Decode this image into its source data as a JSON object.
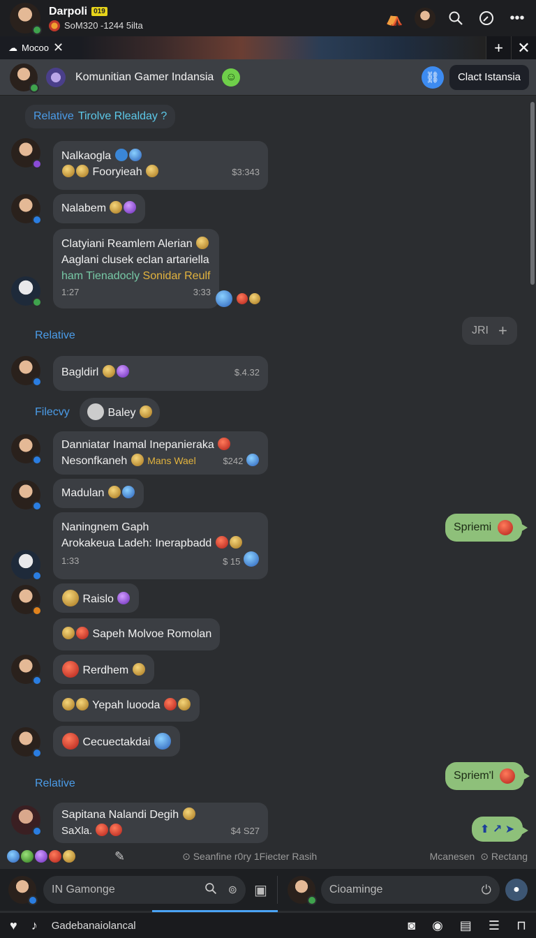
{
  "topbar": {
    "name": "Darpoli",
    "tag": "019",
    "subtitle": "SoM320 -1244 5ilta"
  },
  "banner": {
    "tab_label": "Mocoo"
  },
  "group": {
    "name": "Komunitian Gamer Indansia",
    "pill_label": "Clact Istansia"
  },
  "messages": [
    {
      "type": "system",
      "text": "Relative",
      "alt": "Tirolve Rlealday ?"
    },
    {
      "type": "msg",
      "line1": "Nalkaogla",
      "line2": "Fooryieah",
      "time": "$3:343"
    },
    {
      "type": "msg",
      "line1": "Nalabem"
    },
    {
      "type": "msg",
      "line1": "Clatyiani Reamlem Alerian",
      "line2": "Aaglani clusek eclan artariella",
      "line3a": "ham Tienadocly",
      "line3b": "Sonidar Reulf",
      "time_left": "1:27",
      "time": "3:33"
    },
    {
      "type": "system",
      "text": "Relative"
    },
    {
      "type": "right",
      "text": "JRI"
    },
    {
      "type": "msg",
      "line1": "Bagldirl",
      "time": "$.4.32"
    },
    {
      "type": "system",
      "text": "Filecvy",
      "chip": "Baley"
    },
    {
      "type": "msg",
      "line1": "Danniatar Inamal Inepanieraka",
      "line2a": "Nesonfkaneh",
      "line2b": "Mans Wael",
      "time": "$242"
    },
    {
      "type": "msg",
      "line1": "Madulan"
    },
    {
      "type": "msg",
      "line1": "Naningnem Gaph",
      "line2": "Arokakeua Ladeh: Inerapbadd",
      "time_left": "1:33",
      "time": "$ 15"
    },
    {
      "type": "sent",
      "text": "Spriemi"
    },
    {
      "type": "msg",
      "line1": "Raislo"
    },
    {
      "type": "msg",
      "line1": "Sapeh Molvoe Romolan"
    },
    {
      "type": "msg",
      "line1": "Rerdhem"
    },
    {
      "type": "msg",
      "line1": "Yepah luooda"
    },
    {
      "type": "msg",
      "line1": "Cecuectakdai"
    },
    {
      "type": "system",
      "text": "Relative"
    },
    {
      "type": "sent",
      "text": "Spriem'l"
    },
    {
      "type": "msg",
      "line1": "Sapitana Nalandi Degih",
      "line2": "SaXla.",
      "time": "$4 S27"
    }
  ],
  "reactions": {
    "center": "Seanfine r0ry 1Fiecter Rasih",
    "right1": "Mcanesen",
    "right2": "Rectang"
  },
  "composer": {
    "left_placeholder": "IN Gamonge",
    "right_placeholder": "Cioaminge"
  },
  "bottomnav": {
    "label": "Gadebanaiolancal"
  },
  "colors": {
    "accent": "#4aa3f5",
    "sent_bubble": "#8ec07a",
    "system_text": "#4b9ce8"
  }
}
